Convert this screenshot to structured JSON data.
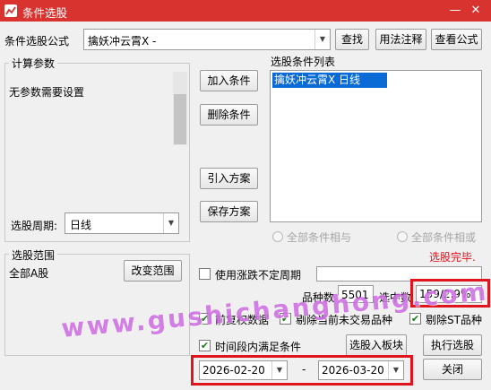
{
  "window": {
    "title": "条件选股",
    "minimize_glyph": "—",
    "close_glyph": "✕"
  },
  "formula": {
    "label": "条件选股公式",
    "value": "擒妖冲云霄X  -"
  },
  "buttons": {
    "find": "查找",
    "usage_notes": "用法注释",
    "view_formula": "查看公式",
    "add_condition": "加入条件",
    "delete_condition": "删除条件",
    "import_scheme": "引入方案",
    "save_scheme": "保存方案",
    "change_range": "改变范围",
    "select_to_board": "选股入板块",
    "execute": "执行选股",
    "close": "关闭"
  },
  "params": {
    "group_label": "计算参数",
    "text": "无参数需要设置"
  },
  "period": {
    "label": "选股周期:",
    "value": "日线"
  },
  "conditions": {
    "label": "选股条件列表",
    "items": [
      "擒妖冲云霄X  日线"
    ]
  },
  "logic": {
    "and_label": "全部条件相与",
    "or_label": "全部条件相或"
  },
  "status": {
    "text": "选股完毕.",
    "color": "#e0141c"
  },
  "range": {
    "group_label": "选股范围",
    "value": "全部A股"
  },
  "options": {
    "variable_period": "使用涨跌不定周期",
    "fq_data": "前复权数据",
    "exclude_untraded": "剔除当前未交易品种",
    "exclude_st": "剔除ST品种",
    "time_range": "时间段内满足条件"
  },
  "stats": {
    "count_label": "品种数",
    "count_value": "5501",
    "selected_label": "选中数",
    "selected_value": "159/2.9%"
  },
  "dates": {
    "start": "2026-02-20",
    "separator": "-",
    "end": "2026-03-20"
  },
  "watermark": "www.gushichanghong.com",
  "colors": {
    "titlebar": "#d9332f",
    "selection": "#0a6ad6",
    "highlight_border": "#e0141c",
    "watermark": "#c454dc"
  }
}
